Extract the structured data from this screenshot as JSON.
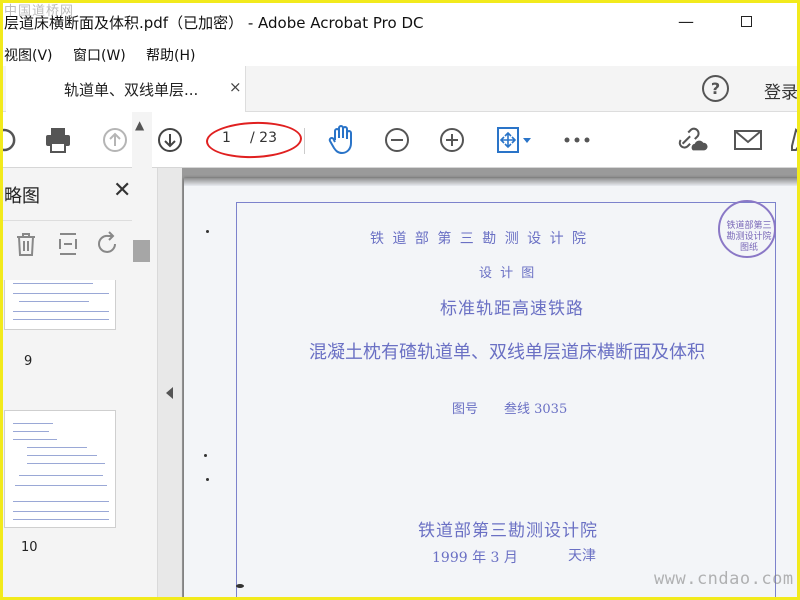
{
  "watermark_top": "中国道桥网",
  "watermark_bottom": "www.cndao.com",
  "window": {
    "title": "层道床横断面及体积.pdf（已加密） - Adobe Acrobat Pro DC",
    "minimize": "—",
    "maximize": "□"
  },
  "menu": {
    "items": [
      "视图(V)",
      "窗口(W)",
      "帮助(H)"
    ]
  },
  "tabs": [
    {
      "label": "轨道单、双线单层...",
      "close": "×"
    }
  ],
  "header_right": {
    "help": "?",
    "login": "登录"
  },
  "toolbar": {
    "page_current": "1",
    "page_total": "/ 23",
    "accent": "#2a74c8",
    "annotation_color": "#e02020"
  },
  "nav_pane": {
    "title": "略图",
    "close": "✕",
    "thumbnails": [
      {
        "label": "9"
      },
      {
        "label": "10"
      }
    ]
  },
  "document": {
    "line1": "铁 道 部 第 三 勘 测 设 计 院",
    "line2": "设 计 图",
    "line3": "标准轨距高速铁路",
    "line4": "混凝土枕有碴轨道单、双线单层道床横断面及体积",
    "drawing_no_label": "图号",
    "drawing_no_value": "叁线 3035",
    "institute": "铁道部第三勘测设计院",
    "date": "1999 年 3 月",
    "city": "天津",
    "seal_text": "铁道部第三勘测设计院 图纸"
  }
}
